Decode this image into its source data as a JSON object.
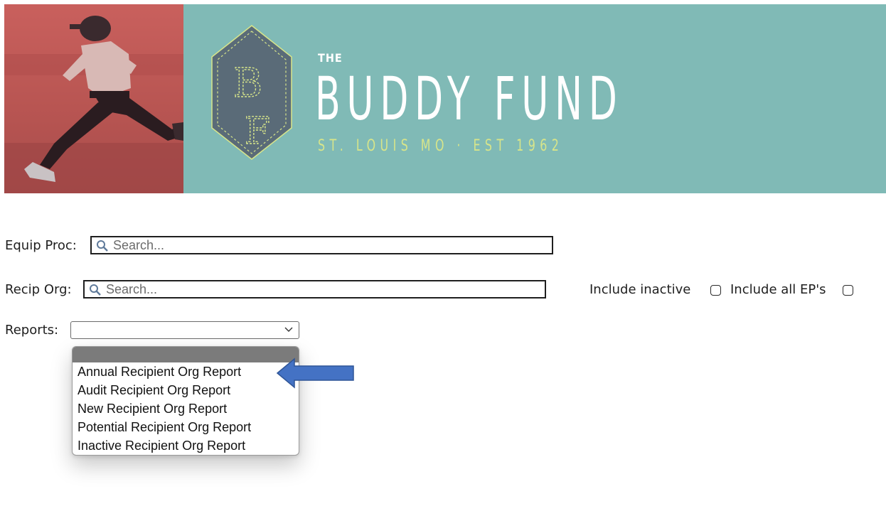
{
  "header": {
    "small_title": "THE",
    "brand_name": "BUDDY FUND",
    "tagline": "ST. LOUIS MO  ·  EST 1962",
    "logo_initials": "BF",
    "colors": {
      "banner": "#80bab6",
      "photo_tint": "#c05a57",
      "logo_hex": "#5a6b78",
      "tagline": "#d7e58a"
    }
  },
  "form": {
    "equip_proc": {
      "label": "Equip Proc:",
      "placeholder": "Search...",
      "icon": "search-icon"
    },
    "recip_org": {
      "label": "Recip Org:",
      "placeholder": "Search...",
      "icon": "search-icon"
    },
    "include_inactive": {
      "label": "Include inactive",
      "checked": false
    },
    "include_all_eps": {
      "label": "Include all EP's",
      "checked": false
    },
    "reports": {
      "label": "Reports:",
      "selected": "",
      "options": [
        "",
        "Annual Recipient Org Report",
        "Audit Recipient Org Report",
        "New Recipient Org Report",
        "Potential Recipient Org Report",
        "Inactive Recipient Org Report"
      ]
    }
  },
  "annotation": {
    "icon": "arrow-left-icon",
    "color": "#4472c4"
  }
}
